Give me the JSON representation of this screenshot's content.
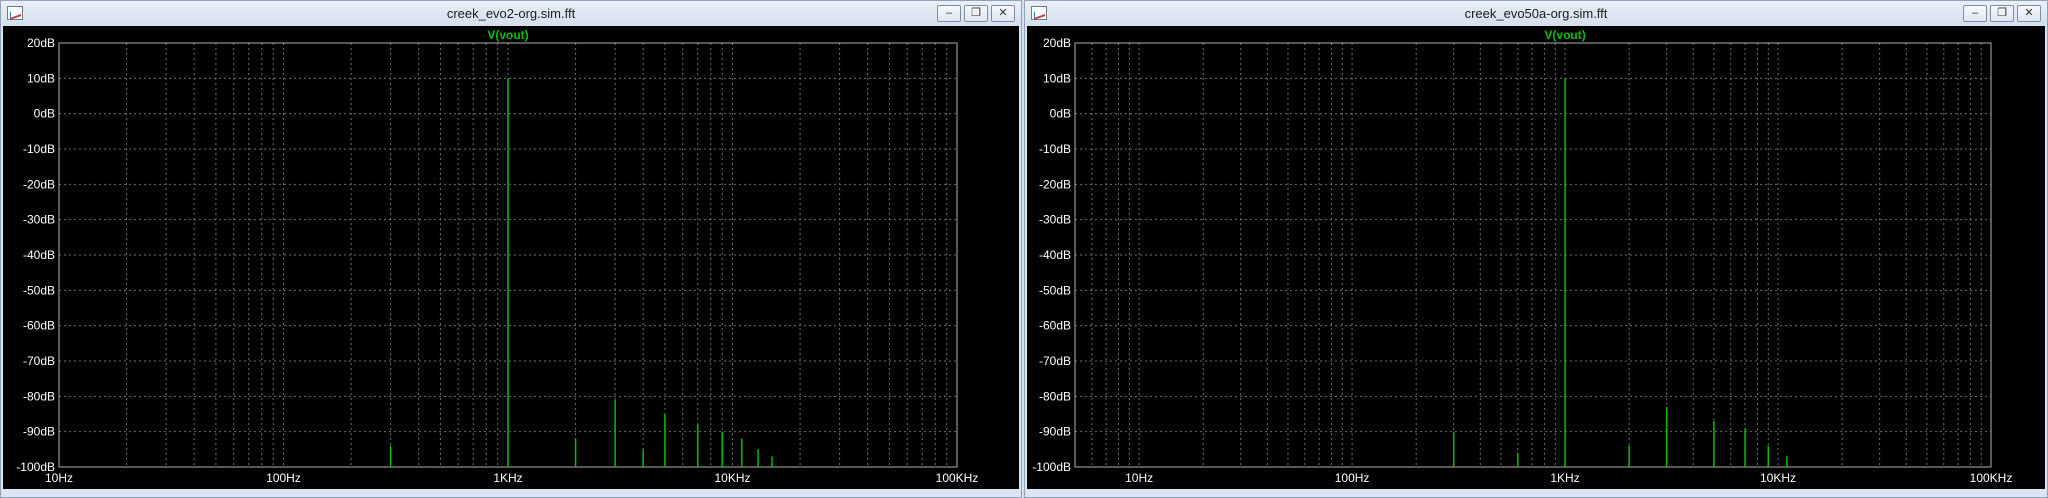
{
  "windows": [
    {
      "title": "creek_evo2-org.sim.fft",
      "buttons": {
        "minimize": "–",
        "restore": "❐",
        "close": "✕"
      },
      "chart_data": {
        "type": "bar",
        "title": "V(vout)",
        "xscale": "log",
        "xlim": [
          10,
          100000
        ],
        "ylim": [
          -100,
          20
        ],
        "grid": true,
        "xticks": [
          "10Hz",
          "100Hz",
          "1KHz",
          "10KHz",
          "100KHz"
        ],
        "yticks": [
          "20dB",
          "10dB",
          "0dB",
          "-10dB",
          "-20dB",
          "-30dB",
          "-40dB",
          "-50dB",
          "-60dB",
          "-70dB",
          "-80dB",
          "-90dB",
          "-100dB"
        ],
        "series": [
          {
            "name": "V(vout)",
            "color": "#00c000",
            "x": [
              300,
              1000,
              2000,
              3000,
              4000,
              5000,
              7000,
              9000,
              11000,
              13000,
              15000
            ],
            "y": [
              -94,
              10,
              -92,
              -81,
              -95,
              -85,
              -88,
              -90,
              -92,
              -95,
              -97
            ]
          }
        ]
      }
    },
    {
      "title": "creek_evo50a-org.sim.fft",
      "buttons": {
        "minimize": "–",
        "restore": "❐",
        "close": "✕"
      },
      "chart_data": {
        "type": "bar",
        "title": "V(vout)",
        "xscale": "log",
        "xlim": [
          5,
          100000
        ],
        "ylim": [
          -100,
          20
        ],
        "grid": true,
        "xticks": [
          "10Hz",
          "100Hz",
          "1KHz",
          "10KHz",
          "100KHz"
        ],
        "yticks": [
          "20dB",
          "10dB",
          "0dB",
          "-10dB",
          "-20dB",
          "-30dB",
          "-40dB",
          "-50dB",
          "-60dB",
          "-70dB",
          "-80dB",
          "-90dB",
          "-100dB"
        ],
        "series": [
          {
            "name": "V(vout)",
            "color": "#00c000",
            "x": [
              300,
              600,
              1000,
              2000,
              3000,
              5000,
              7000,
              9000,
              11000
            ],
            "y": [
              -90,
              -96,
              10,
              -94,
              -83,
              -87,
              -89,
              -94,
              -97
            ]
          }
        ]
      }
    }
  ]
}
